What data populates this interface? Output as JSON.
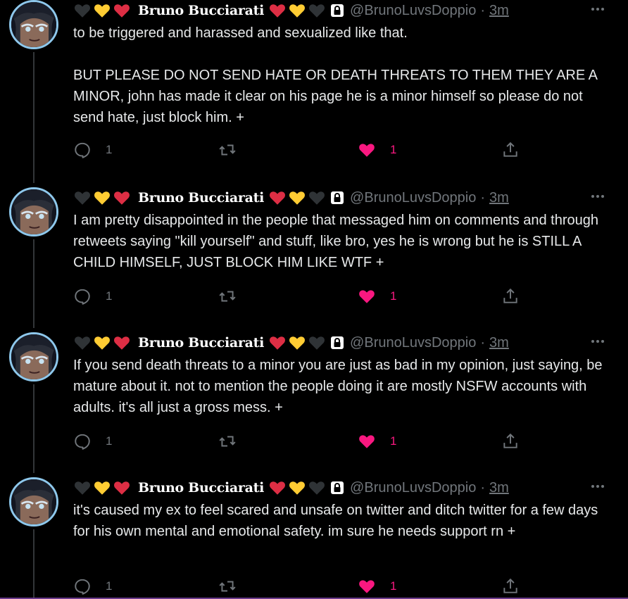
{
  "colors": {
    "background": "#000000",
    "text": "#e7e9ea",
    "muted": "#71767b",
    "like_pink": "#f91880",
    "avatar_ring": "#8ec8ec",
    "heart_black": "#2f3336",
    "heart_yellow": "#ffcc33",
    "heart_red": "#dd2e44"
  },
  "icons": {
    "name_prefix": [
      "black-heart-icon",
      "yellow-heart-icon",
      "red-heart-icon"
    ],
    "name_suffix": [
      "red-heart-icon",
      "yellow-heart-icon",
      "black-heart-icon",
      "lock-icon"
    ],
    "actions": [
      "reply-icon",
      "retweet-icon",
      "like-icon",
      "share-icon"
    ],
    "more": "more-icon"
  },
  "tweets": [
    {
      "display_name": "Bruno Bucciarati",
      "handle": "@BrunoLuvsDoppio",
      "separator": "·",
      "time": "3m",
      "text": "to be triggered and harassed and sexualized like that.\n\nBUT PLEASE DO NOT SEND HATE OR DEATH THREATS TO THEM THEY ARE A MINOR, john has made it clear on his page he is a minor himself so please do not send hate, just block him. +",
      "replies": "1",
      "retweets": "",
      "likes": "1",
      "liked": true
    },
    {
      "display_name": "Bruno Bucciarati",
      "handle": "@BrunoLuvsDoppio",
      "separator": "·",
      "time": "3m",
      "text": "I am pretty disappointed in the people that messaged him on comments and through retweets saying \"kill yourself\" and stuff, like bro, yes he is wrong but he is STILL A CHILD HIMSELF, JUST BLOCK HIM LIKE WTF +",
      "replies": "1",
      "retweets": "",
      "likes": "1",
      "liked": true
    },
    {
      "display_name": "Bruno Bucciarati",
      "handle": "@BrunoLuvsDoppio",
      "separator": "·",
      "time": "3m",
      "text": "If you send death threats to a minor you are just as bad in my opinion, just saying, be mature about it. not to mention the people doing it are mostly NSFW accounts with adults. it's all just a gross mess. +",
      "replies": "1",
      "retweets": "",
      "likes": "1",
      "liked": true
    },
    {
      "display_name": "Bruno Bucciarati",
      "handle": "@BrunoLuvsDoppio",
      "separator": "·",
      "time": "3m",
      "text": "it's caused my ex to feel scared and unsafe on twitter and ditch twitter for a few days for his own mental and emotional safety. im sure he needs support rn +",
      "replies": "1",
      "retweets": "",
      "likes": "1",
      "liked": true
    }
  ]
}
